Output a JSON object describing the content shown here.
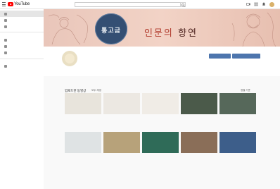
{
  "app": {
    "logo_text": "YouTube"
  },
  "search": {
    "placeholder": ""
  },
  "sidebar": {
    "items": [
      {
        "label": ""
      },
      {
        "label": ""
      },
      {
        "label": ""
      },
      {
        "label": ""
      },
      {
        "label": ""
      },
      {
        "label": ""
      },
      {
        "label": ""
      }
    ]
  },
  "banner": {
    "badge_top": "",
    "badge_name": "통고금",
    "badge_sub": "",
    "title_part1": "인문의",
    "title_part2": "향연"
  },
  "channel": {
    "subscribe_label": "",
    "secondary_label": ""
  },
  "section": {
    "title": "업로드한 동영상",
    "play_all": "모두 재생",
    "sort": "정렬 기준"
  },
  "videos": [
    {
      "title": "",
      "meta": "",
      "duration": ""
    },
    {
      "title": "",
      "meta": "",
      "duration": ""
    },
    {
      "title": "",
      "meta": "",
      "duration": ""
    },
    {
      "title": "",
      "meta": "",
      "duration": ""
    },
    {
      "title": "",
      "meta": "",
      "duration": ""
    },
    {
      "title": "",
      "meta": "",
      "duration": ""
    },
    {
      "title": "",
      "meta": "",
      "duration": ""
    },
    {
      "title": "",
      "meta": "",
      "duration": ""
    },
    {
      "title": "",
      "meta": "",
      "duration": ""
    },
    {
      "title": "",
      "meta": "",
      "duration": ""
    },
    {
      "title": "",
      "meta": "",
      "duration": ""
    },
    {
      "title": "",
      "meta": "",
      "duration": ""
    }
  ],
  "colors": {
    "brand_red": "#ff0000",
    "banner_bg": "#f2d3c6",
    "badge_navy": "#344f73",
    "button_blue": "#4d75ad"
  }
}
